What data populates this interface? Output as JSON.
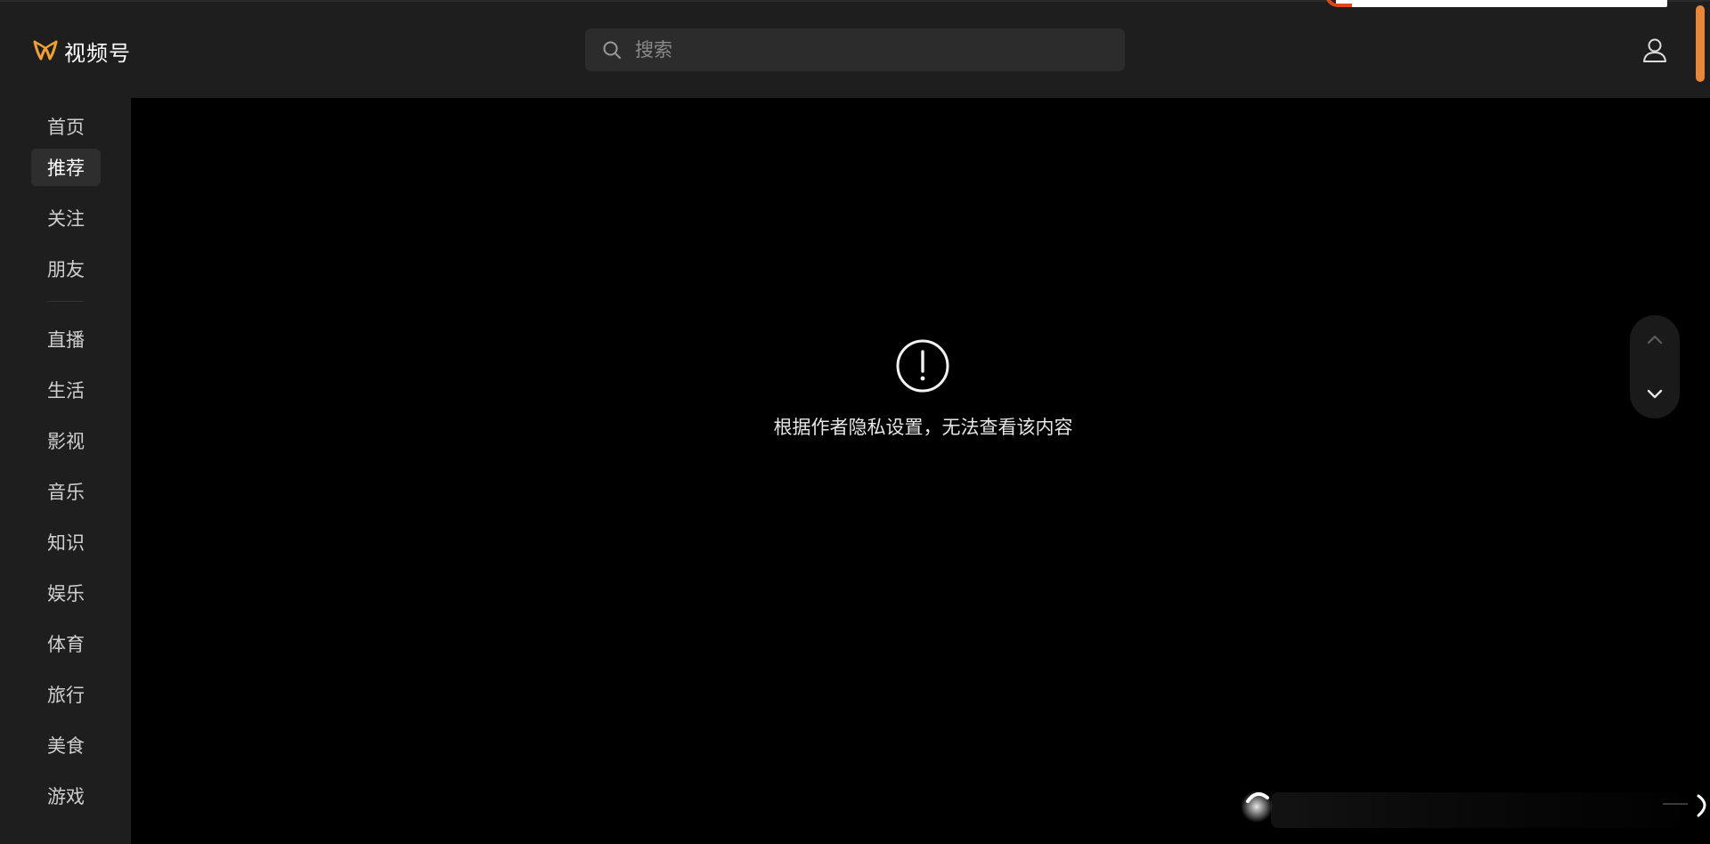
{
  "header": {
    "app_name": "视频号",
    "search_placeholder": "搜索"
  },
  "sidebar": {
    "items": [
      {
        "label": "首页",
        "active": false
      },
      {
        "label": "推荐",
        "active": true
      },
      {
        "label": "关注",
        "active": false
      },
      {
        "label": "朋友",
        "active": false
      },
      {
        "label": "直播",
        "active": false
      },
      {
        "label": "生活",
        "active": false
      },
      {
        "label": "影视",
        "active": false
      },
      {
        "label": "音乐",
        "active": false
      },
      {
        "label": "知识",
        "active": false
      },
      {
        "label": "娱乐",
        "active": false
      },
      {
        "label": "体育",
        "active": false
      },
      {
        "label": "旅行",
        "active": false
      },
      {
        "label": "美食",
        "active": false
      },
      {
        "label": "游戏",
        "active": false
      }
    ]
  },
  "main": {
    "notice_icon": "exclamation-circle-icon",
    "notice_text": "根据作者隐私设置，无法查看该内容"
  },
  "colors": {
    "accent": "#f0a030",
    "scroll_accent": "#e8873a",
    "background": "#000000",
    "chrome": "#1e1e1e"
  },
  "icons": {
    "logo": "channels-logo-icon",
    "search": "search-icon",
    "user": "user-icon",
    "up": "chevron-up-icon",
    "down": "chevron-down-icon"
  }
}
